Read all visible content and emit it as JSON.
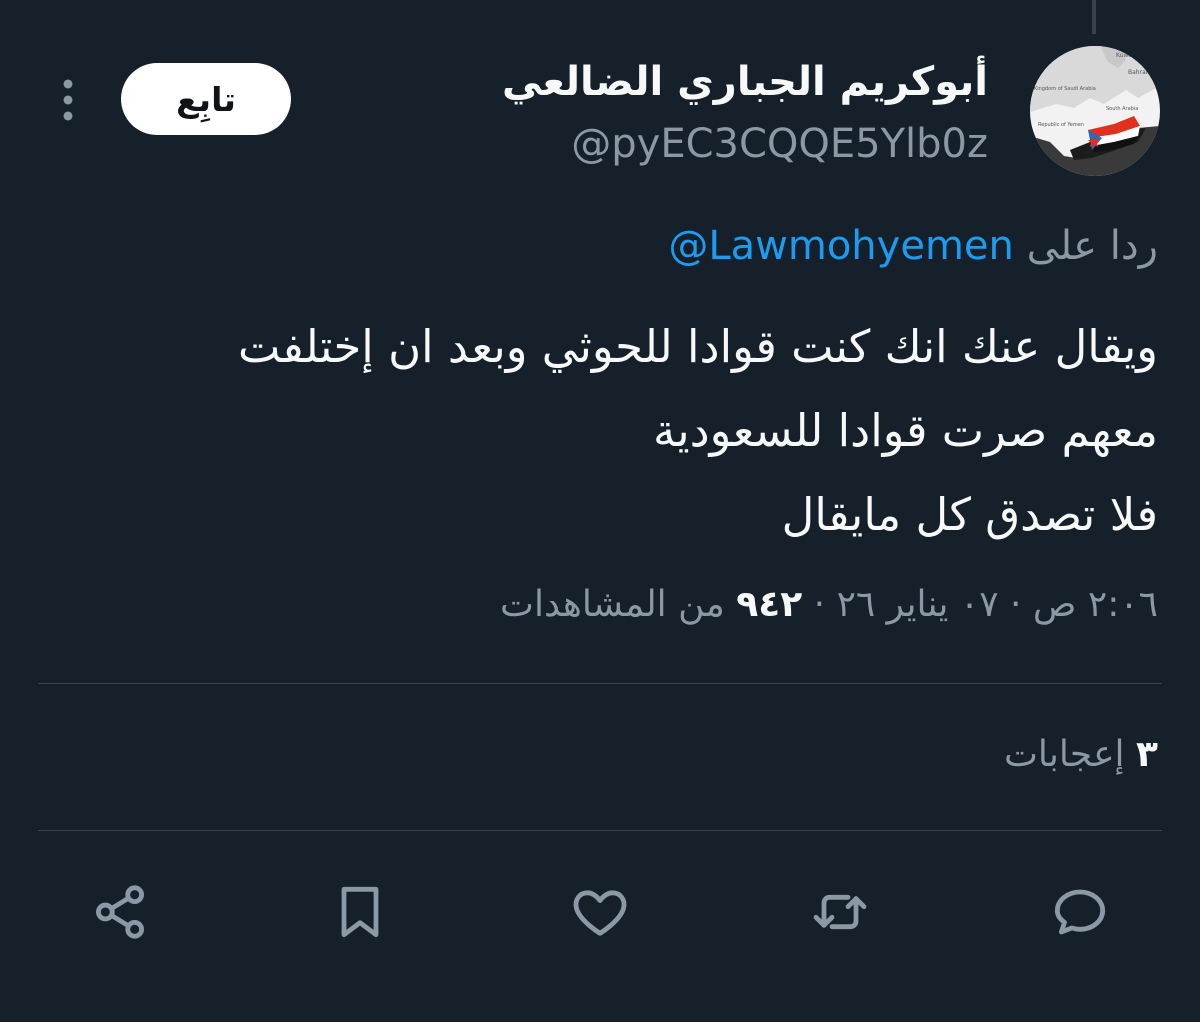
{
  "author": {
    "display_name": "أبوكريم الجباري الضالعي",
    "handle": "@pyEC3CQQE5Ylb0z",
    "avatar": {
      "map_labels": [
        "Kuwait",
        "Bahrain",
        "Kingdom of Saudi Arabia",
        "South Arabia",
        "Republic of Yemen"
      ]
    }
  },
  "follow_button": {
    "label": "تابِع"
  },
  "reply": {
    "prefix": "ردا على",
    "mention": "@Lawmohyemen"
  },
  "tweet": {
    "lines": [
      "ويقال عنك انك كنت قوادا للحوثي وبعد ان إختلفت",
      "معهم صرت قوادا للسعودية",
      "فلا تصدق كل مايقال"
    ]
  },
  "meta": {
    "time": "٢:٠٦ ص",
    "separator": "·",
    "date": "٠٧ يناير ٢٦",
    "views_count": "٩٤٢",
    "views_label": "من المشاهدات"
  },
  "likes": {
    "count": "٣",
    "label": "إعجابات"
  },
  "actions": {
    "icons": [
      "reply-icon",
      "retweet-icon",
      "like-icon",
      "bookmark-icon",
      "share-icon"
    ]
  },
  "colors": {
    "background": "#15202b",
    "text": "#f7f9f9",
    "secondary": "#8b98a5",
    "link": "#1d9bf0",
    "divider": "#38444d",
    "flag_red": "#e0301e",
    "flag_blue": "#1a6fd1"
  }
}
